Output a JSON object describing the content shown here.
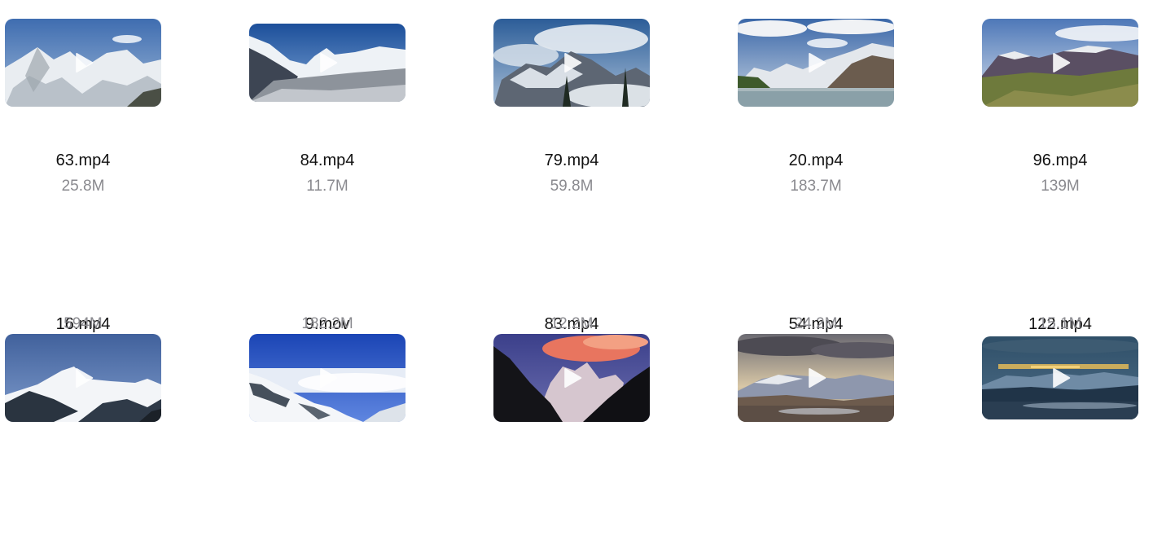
{
  "files": [
    {
      "name": "63.mp4",
      "size": "25.8M",
      "thumb": "thumbnail-snowy-peaks"
    },
    {
      "name": "84.mp4",
      "size": "11.7M",
      "thumb": "thumbnail-glacier-valley"
    },
    {
      "name": "79.mp4",
      "size": "59.8M",
      "thumb": "thumbnail-cloudy-peak"
    },
    {
      "name": "20.mp4",
      "size": "183.7M",
      "thumb": "thumbnail-mountain-lake"
    },
    {
      "name": "96.mp4",
      "size": "139M",
      "thumb": "thumbnail-green-plateau"
    },
    {
      "name": "16.mp4",
      "size": "594M",
      "thumb": "thumbnail-blue-sky-peak"
    },
    {
      "name": "9.mov",
      "size": "182.2M",
      "thumb": "thumbnail-sea-of-clouds"
    },
    {
      "name": "83.mp4",
      "size": "12.2M",
      "thumb": "thumbnail-sunset-peak"
    },
    {
      "name": "54.mp4",
      "size": "24.2M",
      "thumb": "thumbnail-dusk-range"
    },
    {
      "name": "122.mp4",
      "size": "15.1M",
      "thumb": "thumbnail-twilight-plains"
    }
  ],
  "colors": {
    "name_text": "#111111",
    "size_text": "#8a8a8f",
    "play_icon": "#ffffff"
  }
}
